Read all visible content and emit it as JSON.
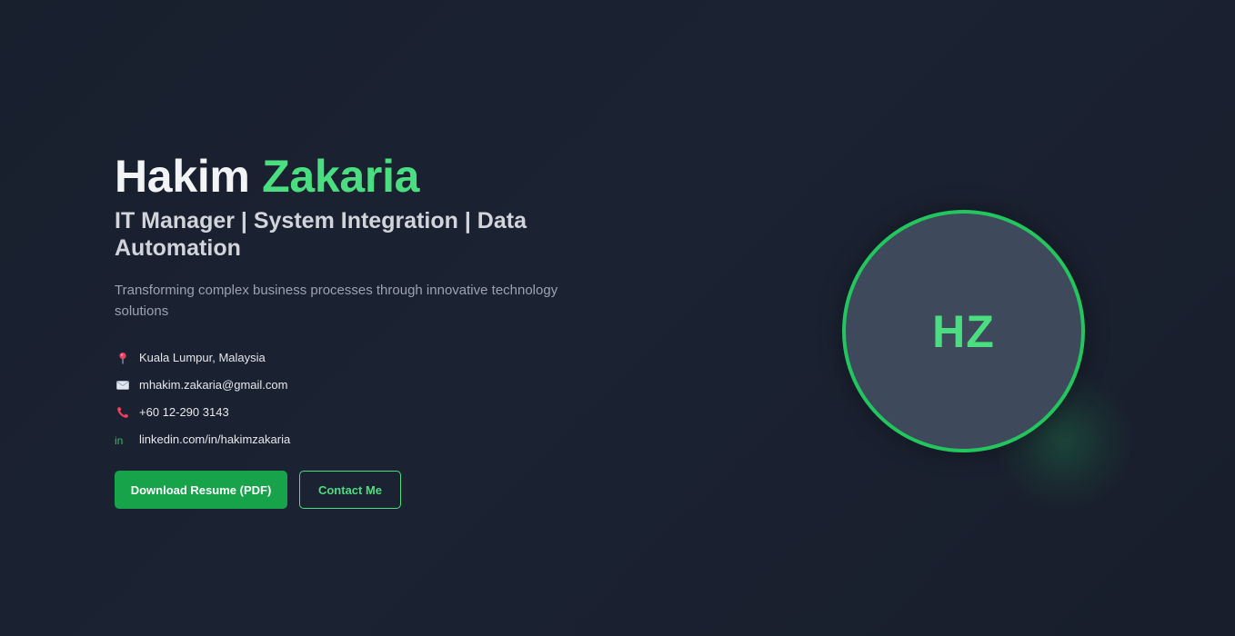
{
  "hero": {
    "first_name": "Hakim",
    "last_name": "Zakaria",
    "role": "IT Manager | System Integration | Data Automation",
    "tagline": "Transforming complex business processes through innovative technology solutions",
    "accent_color": "#4ade80",
    "contacts": [
      {
        "icon": "location-pin-icon",
        "text": "Kuala Lumpur, Malaysia"
      },
      {
        "icon": "envelope-icon",
        "text": "mhakim.zakaria@gmail.com"
      },
      {
        "icon": "phone-icon",
        "text": "+60 12-290 3143"
      },
      {
        "icon": "linkedin-icon",
        "icon_text": "in",
        "text": "linkedin.com/in/hakimzakaria"
      }
    ],
    "buttons": {
      "download_label": "Download Resume (PDF)",
      "contact_label": "Contact Me"
    }
  },
  "avatar": {
    "initials": "HZ",
    "border_color": "#22c55e",
    "background_color": "#3e4a5b"
  }
}
